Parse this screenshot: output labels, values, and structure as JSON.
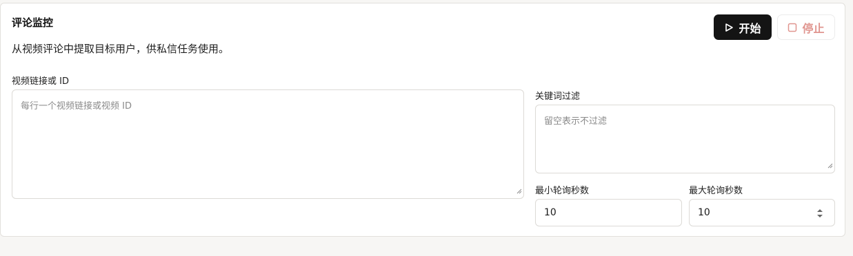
{
  "panel": {
    "title": "评论监控",
    "description": "从视频评论中提取目标用户，供私信任务使用。"
  },
  "actions": {
    "start_label": "开始",
    "start_icon": "play-icon",
    "stop_label": "停止",
    "stop_icon": "stop-square-icon"
  },
  "video_links": {
    "label": "视频链接或 ID",
    "placeholder": "每行一个视频链接或视频 ID",
    "value": ""
  },
  "keyword_filter": {
    "label": "关键词过滤",
    "placeholder": "留空表示不过滤",
    "value": ""
  },
  "min_poll": {
    "label": "最小轮询秒数",
    "value": "10"
  },
  "max_poll": {
    "label": "最大轮询秒数",
    "value": "10"
  },
  "colors": {
    "start_bg": "#141414",
    "stop_text": "#e0958f",
    "page_bg": "#f7f6f4"
  }
}
